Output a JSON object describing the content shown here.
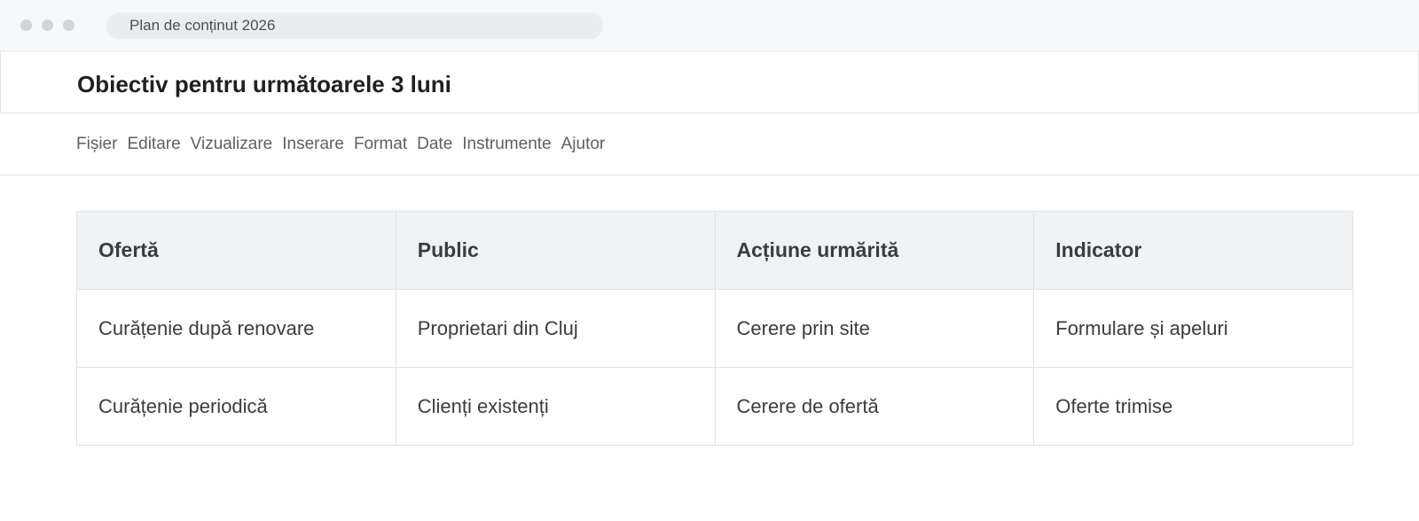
{
  "window": {
    "url_text": "Plan de conținut 2026"
  },
  "document": {
    "title": "Obiectiv pentru următoarele 3 luni"
  },
  "menu": {
    "items": [
      "Fișier",
      "Editare",
      "Vizualizare",
      "Inserare",
      "Format",
      "Date",
      "Instrumente",
      "Ajutor"
    ]
  },
  "table": {
    "headers": [
      "Ofertă",
      "Public",
      "Acțiune urmărită",
      "Indicator"
    ],
    "rows": [
      [
        "Curățenie după renovare",
        "Proprietari din Cluj",
        "Cerere prin site",
        "Formulare și apeluri"
      ],
      [
        "Curățenie periodică",
        "Clienți existenți",
        "Cerere de ofertă",
        "Oferte trimise"
      ]
    ]
  }
}
